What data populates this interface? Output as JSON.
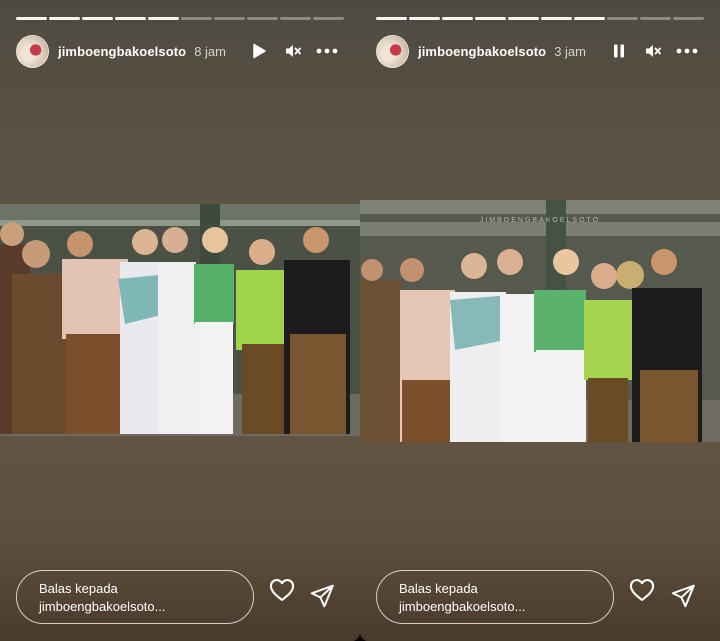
{
  "stories": [
    {
      "username": "jimboengbakoelsoto",
      "time": "8 jam",
      "progress_segments_total": 10,
      "progress_segments_viewed": 5,
      "playback_state": "paused",
      "playback_icon": "play-icon",
      "muted": true,
      "reply_placeholder": "Balas kepada jimboengbakoelsoto..."
    },
    {
      "username": "jimboengbakoelsoto",
      "time": "3 jam",
      "progress_segments_total": 10,
      "progress_segments_viewed": 7,
      "playback_state": "playing",
      "playback_icon": "pause-icon",
      "muted": true,
      "watermark": "JIMBOENGBAKOELSOTO",
      "reply_placeholder": "Balas kepada jimboengbakoelsoto..."
    }
  ],
  "icons": {
    "mute": "speaker-muted-icon",
    "more": "more-options-icon",
    "like": "heart-icon",
    "share": "send-icon"
  },
  "colors": {
    "background": "#5f5545",
    "text": "#ffffff"
  }
}
